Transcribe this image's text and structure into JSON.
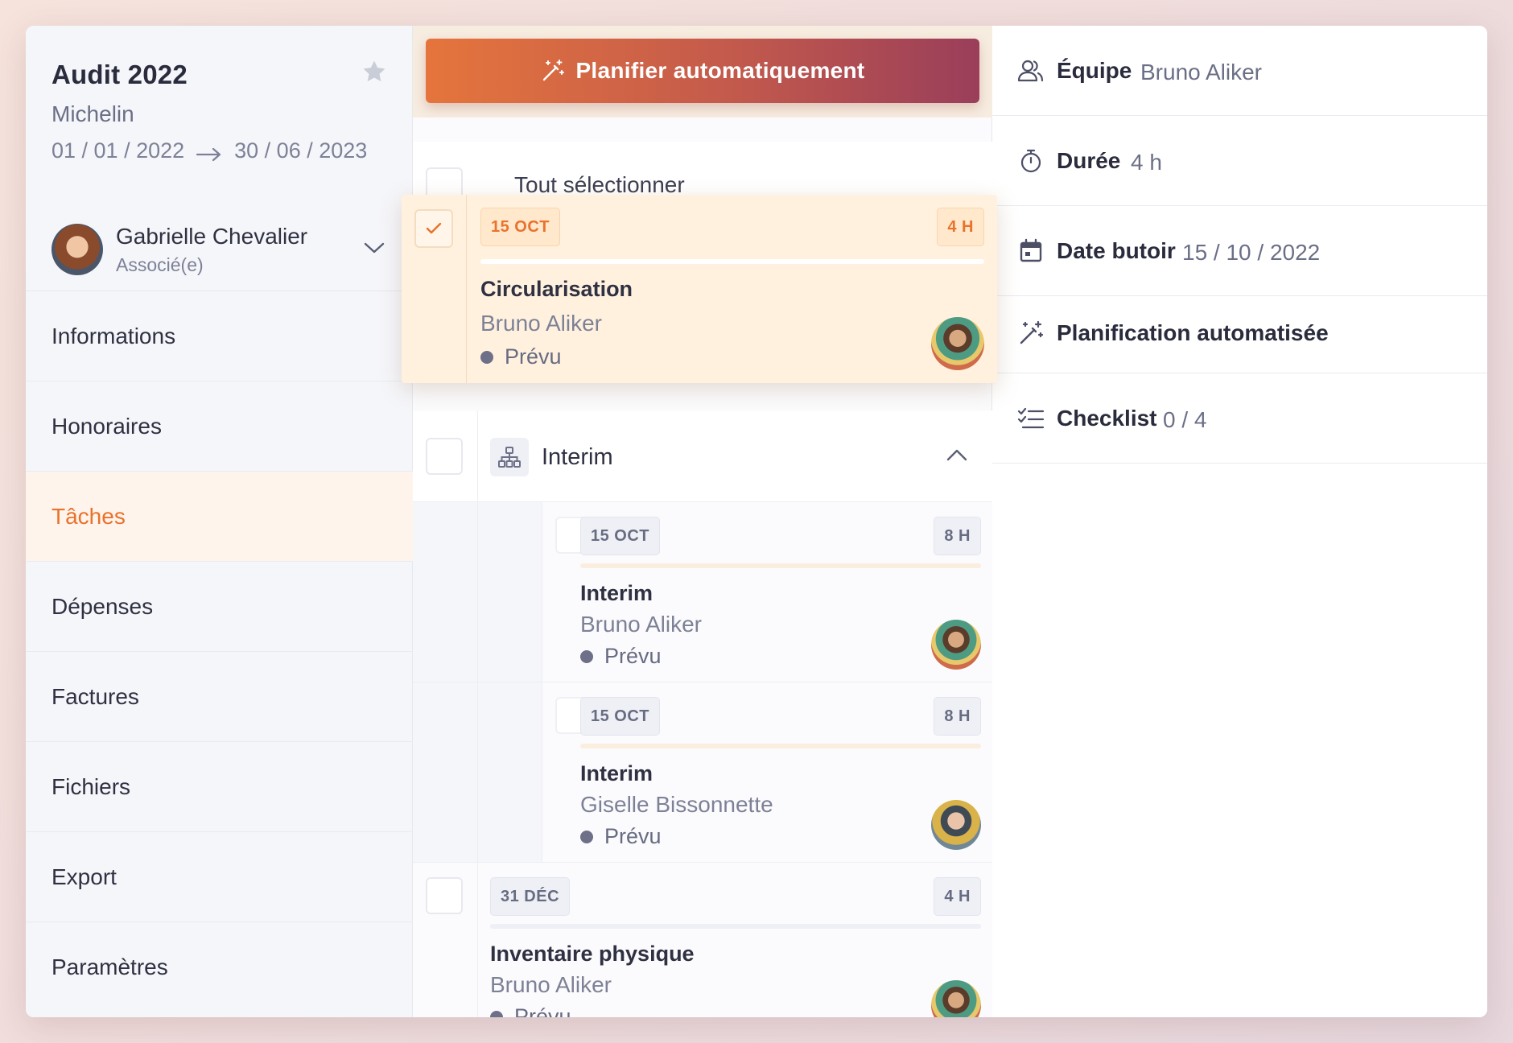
{
  "project": {
    "title": "Audit 2022",
    "client": "Michelin",
    "date_start": "01 / 01 / 2022",
    "date_end": "30 / 06 / 2023"
  },
  "user": {
    "name": "Gabrielle Chevalier",
    "role": "Associé(e)"
  },
  "nav": [
    {
      "label": "Informations"
    },
    {
      "label": "Honoraires"
    },
    {
      "label": "Tâches",
      "active": true
    },
    {
      "label": "Dépenses"
    },
    {
      "label": "Factures"
    },
    {
      "label": "Fichiers"
    },
    {
      "label": "Export"
    },
    {
      "label": "Paramètres"
    }
  ],
  "toolbar": {
    "plan_label": "Planifier automatiquement",
    "select_all": "Tout sélectionner"
  },
  "tasks": {
    "selected": {
      "date": "15 OCT",
      "duration": "4 H",
      "title": "Circularisation",
      "assignee": "Bruno Aliker",
      "status": "Prévu",
      "checked": true
    },
    "group": {
      "label": "Interim",
      "items": [
        {
          "date": "15 OCT",
          "duration": "8 H",
          "title": "Interim",
          "assignee": "Bruno Aliker",
          "status": "Prévu"
        },
        {
          "date": "15 OCT",
          "duration": "8 H",
          "title": "Interim",
          "assignee": "Giselle Bissonnette",
          "status": "Prévu"
        }
      ]
    },
    "last": {
      "date": "31 DÉC",
      "duration": "4 H",
      "title": "Inventaire physique",
      "assignee": "Bruno Aliker",
      "status": "Prévu"
    }
  },
  "details": {
    "team": {
      "key": "Équipe",
      "value": "Bruno Aliker"
    },
    "duration": {
      "key": "Durée",
      "value": "4 h"
    },
    "deadline": {
      "key": "Date butoir",
      "value": "15 / 10 / 2022"
    },
    "auto": {
      "key": "Planification automatisée"
    },
    "checklist": {
      "key": "Checklist",
      "value": "0 / 4"
    }
  },
  "colors": {
    "accent": "#e9722c",
    "active_bg": "#fff4ec",
    "highlight_card": "#fff1de"
  }
}
